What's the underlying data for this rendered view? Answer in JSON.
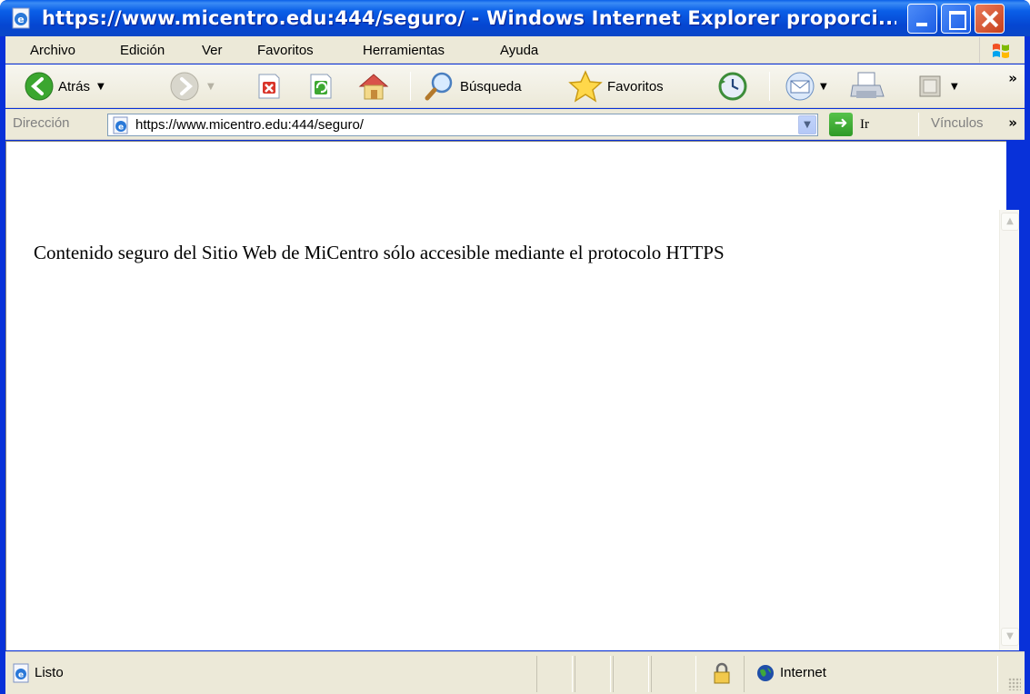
{
  "window": {
    "title": "https://www.micentro.edu:444/seguro/ - Windows Internet Explorer proporci..."
  },
  "menubar": {
    "items": [
      {
        "label": "Archivo"
      },
      {
        "label": "Edición"
      },
      {
        "label": "Ver"
      },
      {
        "label": "Favoritos"
      },
      {
        "label": "Herramientas"
      },
      {
        "label": "Ayuda"
      }
    ]
  },
  "toolbar": {
    "back_label": "Atrás",
    "search_label": "Búsqueda",
    "favorites_label": "Favoritos",
    "more_chevron": "»"
  },
  "address": {
    "label": "Dirección",
    "value": "https://www.micentro.edu:444/seguro/",
    "go_label": "Ir",
    "links_label": "Vínculos",
    "links_chevron": "»"
  },
  "content": {
    "text": "Contenido seguro del Sitio Web de MiCentro sólo accesible mediante el protocolo HTTPS"
  },
  "statusbar": {
    "status_text": "Listo",
    "zone_text": "Internet"
  },
  "colors": {
    "titlebar": "#0a5fe8",
    "chrome": "#ece9d8",
    "close_button": "#c7401c"
  },
  "icons": [
    "ie-icon",
    "minimize-icon",
    "maximize-icon",
    "close-icon",
    "windows-flag-icon",
    "back-arrow-icon",
    "forward-arrow-icon",
    "stop-icon",
    "refresh-icon",
    "home-icon",
    "search-icon",
    "favorites-star-icon",
    "history-icon",
    "mail-icon",
    "print-icon",
    "edit-icon",
    "page-icon",
    "go-arrow-icon",
    "lock-icon",
    "internet-globe-icon"
  ]
}
